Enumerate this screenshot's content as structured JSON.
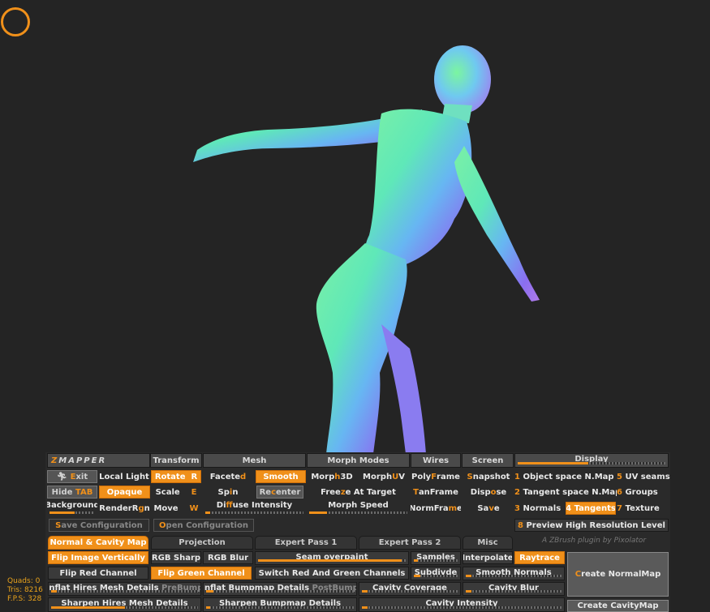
{
  "stats": {
    "quads": "Quads: 0",
    "tris": "Tris: 8216",
    "fps": "F.P.S: 328"
  },
  "credit": "A ZBrush plugin by Pixolator",
  "headers": {
    "logo_z": "Z",
    "logo_rest": "MAPPER",
    "transform": "Transform",
    "mesh": "Mesh",
    "morph_modes": "Morph Modes",
    "wires": "Wires",
    "screen": "Screen",
    "display": "Display"
  },
  "transform": {
    "exit_k": "E",
    "exit_rest": "xit",
    "hide_pre": "Hide ",
    "hide_k": "TAB",
    "background": "Background",
    "local_light": "Local Light",
    "opaque": "Opaque",
    "render_pre": "RenderR",
    "render_k": "g",
    "render_post": "n",
    "rotate": "Rotate",
    "rotate_k": "R",
    "scale": "Scale",
    "scale_k": "E",
    "move": "Move",
    "move_k": "W"
  },
  "mesh": {
    "faceted_pre": "Facete",
    "faceted_k": "d",
    "smooth": "Smooth",
    "spin_pre": "Sp",
    "spin_k": "i",
    "spin_post": "n",
    "recenter_pre": "Re",
    "recenter_k": "c",
    "recenter_post": "enter",
    "diffuse_pre": "Di",
    "diffuse_k": "f",
    "diffuse_post": "fuse Intensity"
  },
  "morph": {
    "m3d_pre": "Morp",
    "m3d_k": "h",
    "m3d_post": " 3D",
    "muv_pre": "Morph ",
    "muv_k": "U",
    "muv_post": "V",
    "freeze_pre": "Free",
    "freeze_k": "z",
    "freeze_post": "e At Target",
    "speed": "Morph Speed"
  },
  "wires": {
    "poly_pre": "Poly",
    "poly_k": "F",
    "poly_post": "rame",
    "tan_pre": "",
    "tan_k": "T",
    "tan_post": "anFrame",
    "norm_pre": "NormFra",
    "norm_k": "m",
    "norm_post": "e"
  },
  "screen": {
    "snap_pre": "",
    "snap_k": "S",
    "snap_post": "napshot",
    "dispose_pre": "Disp",
    "dispose_k": "o",
    "dispose_post": "se",
    "save_pre": "Sa",
    "save_k": "v",
    "save_post": "e"
  },
  "display": {
    "obj_n": "1",
    "obj": "Object space N.Map",
    "uv_n": "5",
    "uv": "UV seams",
    "tan_n": "2",
    "tan": "Tangent space N.Map",
    "groups_n": "6",
    "groups": "Groups",
    "norm_n": "3",
    "norm": "Normals",
    "tangents_n": "4",
    "tangents": "Tangents",
    "tex_n": "7",
    "tex": "Texture",
    "preview_n": "8",
    "preview": "Preview High Resolution Level"
  },
  "config": {
    "save_k": "S",
    "save_rest": "ave Configuration",
    "open_k": "O",
    "open_rest": "pen Configuration"
  },
  "tabs": {
    "normal_cavity": "Normal & Cavity Map",
    "projection": "Projection",
    "expert1": "Expert Pass 1",
    "expert2": "Expert Pass 2",
    "misc": "Misc"
  },
  "options": {
    "flip_image": "Flip Image Vertically",
    "rgb_sharp": "RGB Sharp",
    "rgb_blur": "RGB Blur",
    "seam": "Seam overpaint",
    "samples": "Samples",
    "interpolate": "Interpolate",
    "raytrace": "Raytrace",
    "flip_red": "Flip Red Channel",
    "flip_green": "Flip Green Channel",
    "switch_rg": "Switch Red And Green Channels",
    "subdivide": "Subdivde",
    "smooth_normals": "Smooth Normals",
    "inflat_hires": "Inflat Hires Mesh Details",
    "prebump": "PreBump",
    "inflat_bump": "Inflat Bumpmap Details",
    "postbump": "PostBump",
    "cavity_coverage": "Cavity Coverage",
    "cavity_blur": "Cavity Blur",
    "sharpen_hires": "Sharpen Hires Mesh Details",
    "sharpen_bump": "Sharpen Bumpmap Details",
    "cavity_intensity": "Cavity Intensity",
    "create_normal_k": "C",
    "create_normal_rest": "reate NormalMap",
    "create_cavity": "Create CavityMap"
  },
  "slider_levels": {
    "background": 0.55,
    "diffuse": 0.05,
    "morph_speed": 0.18,
    "display": 0.48,
    "seam": 0.97,
    "samples": 0.1,
    "subdivide": 0.15,
    "smooth_normals": 0.06,
    "inflat_hires": 0.04,
    "inflat_bump": 0.05,
    "cavity_coverage": 0.06,
    "cavity_blur": 0.06,
    "sharpen_hires": 0.5,
    "sharpen_bump": 0.03,
    "cavity_intensity": 0.03
  },
  "colors": {
    "accent": "#f0901a",
    "panel": "#2a2a2a",
    "viewport": "#242424"
  }
}
